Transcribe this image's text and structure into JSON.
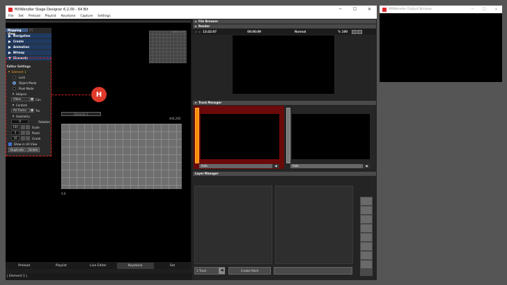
{
  "window": {
    "title": "MXWendler Stage Designer 6.2.00 - 64 Bit",
    "minimize": "─",
    "maximize": "☐",
    "close": "✕"
  },
  "menu": [
    "File",
    "Set",
    "Preload",
    "Playlist",
    "Keystone",
    "Capture",
    "Settings"
  ],
  "sidebar": {
    "tab": "Mapping View",
    "tab_extra": "(?)",
    "sections": [
      "Navigation",
      "Create",
      "Animation",
      "Bitmap",
      "Elements"
    ],
    "editor_settings": "Editor Settings",
    "element_name": "Element 1",
    "lock": "Lock",
    "object_mode": "Object Mode",
    "pixel_mode": "Pixel Mode",
    "helpers": "Helpers",
    "helpers_select": "Video",
    "helpers_opt": "Con",
    "content": "Content",
    "content_select": "All Tracks",
    "content_opt": "Tra",
    "geometry": "Geometry",
    "rotation_value": "0",
    "rotation_label": "Rotation",
    "scale_value": "100",
    "scale_label": "Scale",
    "pixels_value": "2",
    "pixels_label": "Pixels",
    "grade_value": "16",
    "grade_label": "Grade",
    "show_uv": "Show in UV View",
    "duplicate": "Duplicate",
    "delete": "Delete"
  },
  "canvas": {
    "element_label": "Element 1",
    "coords_tr": "444,265",
    "coords_bl": "0,0",
    "thumb_label": "1280 x 720"
  },
  "annotation": {
    "label": "H"
  },
  "bottom_tabs": [
    "Preload",
    "Playlist",
    "Live Editor",
    "Keystone",
    "Set"
  ],
  "status": "| Element 1 |",
  "file_browser": {
    "title": "File Browser"
  },
  "render": {
    "title": "Render",
    "timecode": "13:42:07",
    "time": "00:00:09",
    "mode": "Normal",
    "percent": "% 100"
  },
  "track_manager": {
    "title": "Track Manager",
    "track1_label": "fade",
    "track2_label": "fade"
  },
  "layer_manager": {
    "title": "Layer Manager",
    "track_select": "1 Track",
    "create_patch": "Create Patch"
  },
  "output_window": {
    "title": "MXWendler Output Window"
  },
  "colors": {
    "accent": "#e03a2a",
    "track_active": "#6b0a0a",
    "track_fill": "#ff8c00"
  }
}
